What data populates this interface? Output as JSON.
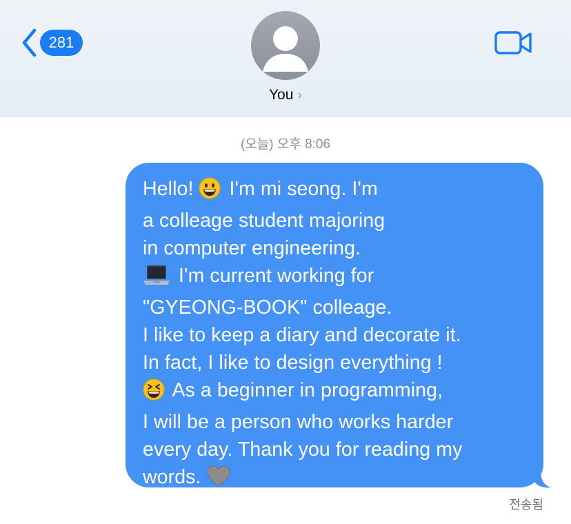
{
  "header": {
    "unread_count": "281",
    "contact_name": "You",
    "chevron": "›",
    "icons": {
      "back": "chevron-left-icon",
      "video": "video-camera-icon",
      "avatar": "person-silhouette-icon"
    },
    "accent": "#1a7cf5"
  },
  "conversation": {
    "timestamp": "(오늘) 오후 8:06",
    "message": {
      "lines": [
        {
          "text": "Hello! ",
          "emoji": "grinning-face-emoji",
          "after": " I'm mi seong. I'm"
        },
        {
          "text": "a colleage student majoring"
        },
        {
          "text": "in computer engineering."
        },
        {
          "emoji": "laptop-emoji",
          "after": " I'm current working for"
        },
        {
          "text": "\"GYEONG-BOOK\" colleage."
        },
        {
          "text": "I like to keep a diary and decorate it."
        },
        {
          "text": "In fact, I like to design everything !"
        },
        {
          "emoji": "grinning-squinting-face-emoji",
          "after": " As a beginner in programming,"
        },
        {
          "text": "I will be a person who works harder"
        },
        {
          "text": "every day. Thank you for reading my"
        },
        {
          "text": "words. ",
          "emoji": "grey-heart-emoji"
        }
      ],
      "bubble_color": "#4592f6"
    },
    "status": "전송됨"
  }
}
